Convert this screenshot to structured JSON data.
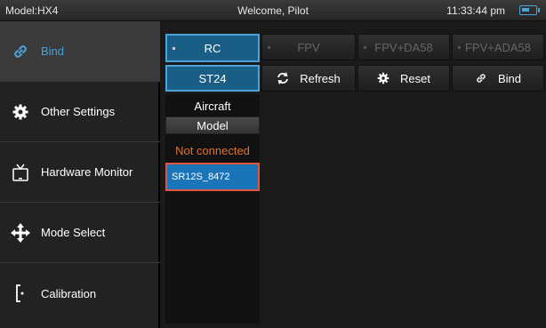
{
  "status_bar": {
    "model": "Model:HX4",
    "welcome": "Welcome, Pilot",
    "time": "11:33:44 pm",
    "battery_icon": "battery-icon"
  },
  "sidebar": {
    "items": [
      {
        "label": "Bind",
        "icon": "link-icon",
        "active": true
      },
      {
        "label": "Other Settings",
        "icon": "gear-icon",
        "active": false
      },
      {
        "label": "Hardware Monitor",
        "icon": "monitor-icon",
        "active": false
      },
      {
        "label": "Mode Select",
        "icon": "move-arrows-icon",
        "active": false
      },
      {
        "label": "Calibration",
        "icon": "calibration-icon",
        "active": false
      }
    ]
  },
  "bind": {
    "tabs": [
      {
        "label": "RC",
        "selected": true,
        "enabled": true
      },
      {
        "label": "FPV",
        "selected": false,
        "enabled": false
      },
      {
        "label": "FPV+DA58",
        "selected": false,
        "enabled": false
      },
      {
        "label": "FPV+ADA58",
        "selected": false,
        "enabled": false
      }
    ],
    "protocol": "ST24",
    "actions": {
      "refresh": "Refresh",
      "reset": "Reset",
      "bind": "Bind"
    },
    "list_header": "Aircraft",
    "model_button": "Model",
    "connection_status": "Not connected",
    "receivers": [
      "SR12S_8472"
    ]
  },
  "colors": {
    "accent": "#4aa3d9",
    "selected_fill": "#1a5e86",
    "status_warning": "#e0742e",
    "highlight_border": "#e5533d"
  }
}
